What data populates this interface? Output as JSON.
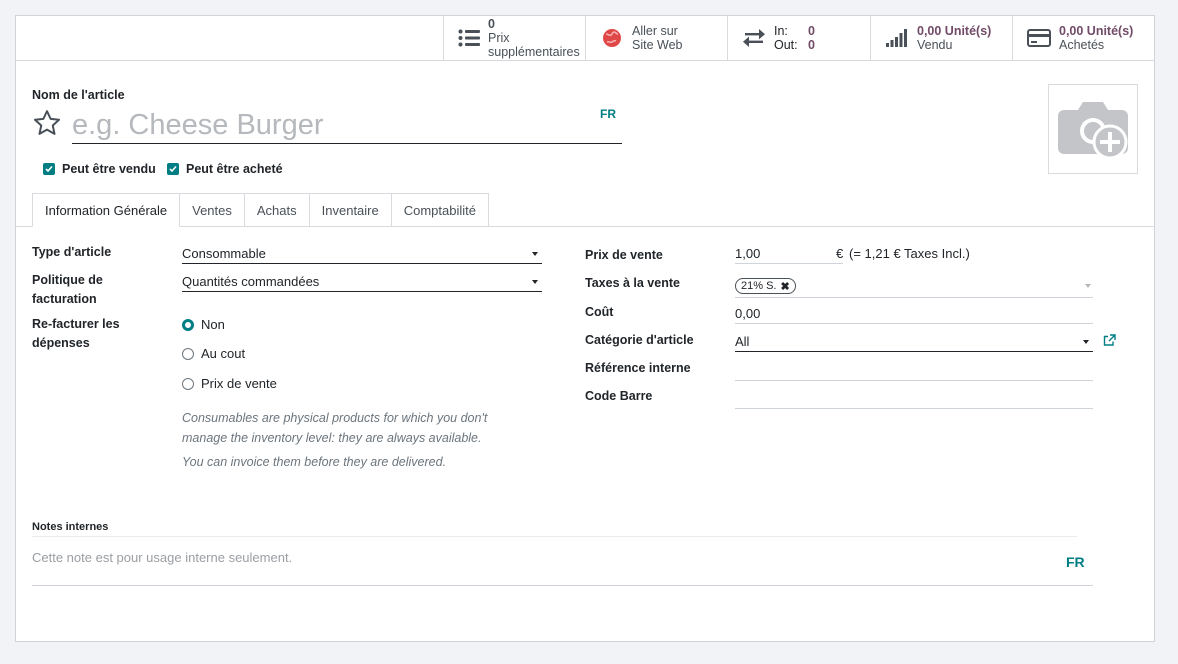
{
  "button_box": {
    "extra_prices": {
      "value": "0",
      "label": "Prix supplémentaires"
    },
    "website": {
      "line1": "Aller sur",
      "line2": "Site Web"
    },
    "in_out": {
      "in_label": "In:",
      "in_value": "0",
      "out_label": "Out:",
      "out_value": "0"
    },
    "sold": {
      "value": "0,00 Unité(s)",
      "label": "Vendu"
    },
    "purchased": {
      "value": "0,00 Unité(s)",
      "label": "Achetés"
    }
  },
  "product": {
    "name_label": "Nom de l'article",
    "name_placeholder": "e.g. Cheese Burger",
    "lang": "FR",
    "can_be_sold_label": "Peut être vendu",
    "can_be_purchased_label": "Peut être acheté"
  },
  "tabs": [
    {
      "label": "Information Générale"
    },
    {
      "label": "Ventes"
    },
    {
      "label": "Achats"
    },
    {
      "label": "Inventaire"
    },
    {
      "label": "Comptabilité"
    }
  ],
  "left": {
    "type_label": "Type d'article",
    "type_value": "Consommable",
    "invoice_policy_label": "Politique de facturation",
    "invoice_policy_value": "Quantités commandées",
    "reinvoice_label": "Re-facturer les dépenses",
    "reinvoice_options": [
      "Non",
      "Au cout",
      "Prix de vente"
    ],
    "help_line1": "Consumables are physical products for which you don't",
    "help_line2": "manage the inventory level: they are always available.",
    "help_line3": "You can invoice them before they are delivered."
  },
  "right": {
    "sale_price_label": "Prix de vente",
    "sale_price_value": "1,00",
    "currency": "€",
    "taxes_incl": "(= 1,21 € Taxes Incl.)",
    "sale_taxes_label": "Taxes à la vente",
    "tax_tag": "21% S.",
    "cost_label": "Coût",
    "cost_value": "0,00",
    "category_label": "Catégorie d'article",
    "category_value": "All",
    "internal_ref_label": "Référence interne",
    "barcode_label": "Code Barre"
  },
  "notes": {
    "label": "Notes internes",
    "placeholder": "Cette note est pour usage interne seulement.",
    "lang": "FR"
  },
  "colors": {
    "accent": "#017e84",
    "brand": "#714b67"
  }
}
